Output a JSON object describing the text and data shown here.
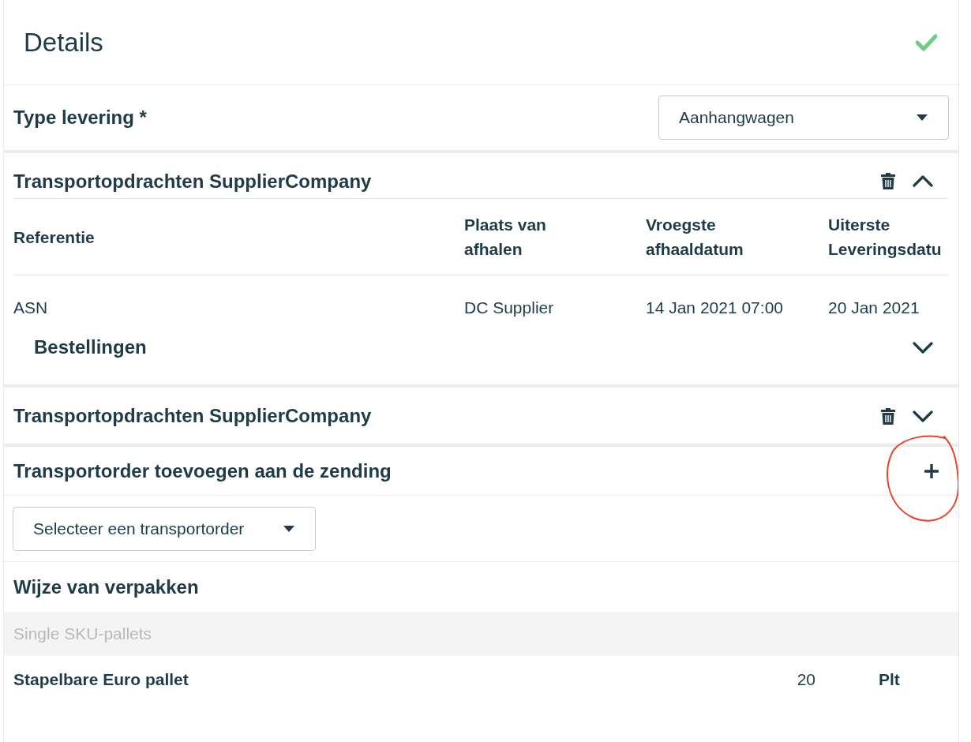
{
  "header": {
    "title": "Details",
    "complete": true
  },
  "delivery_type": {
    "label": "Type levering *",
    "value": "Aanhangwagen"
  },
  "transport_assignments": [
    {
      "title": "Transportopdrachten SupplierCompany",
      "expanded": true,
      "columns": [
        "Referentie",
        "Plaats van afhalen",
        "Vroegste afhaaldatum",
        "Uiterste Leveringsdatu"
      ],
      "rows": [
        [
          "ASN",
          "DC Supplier",
          "14 Jan 2021 07:00",
          "20 Jan 2021"
        ]
      ],
      "orders": {
        "title": "Bestellingen",
        "expanded": false
      }
    },
    {
      "title": "Transportopdrachten SupplierCompany",
      "expanded": false
    }
  ],
  "add_transport_order": {
    "title": "Transportorder toevoegen aan de zending",
    "select": {
      "placeholder": "Selecteer een transportorder"
    }
  },
  "packaging": {
    "title": "Wijze van verpakken",
    "groups": [
      {
        "name": "Single SKU-pallets",
        "items": [
          {
            "name": "Stapelbare Euro pallet",
            "quantity": "20",
            "unit": "Plt"
          }
        ]
      }
    ]
  }
}
